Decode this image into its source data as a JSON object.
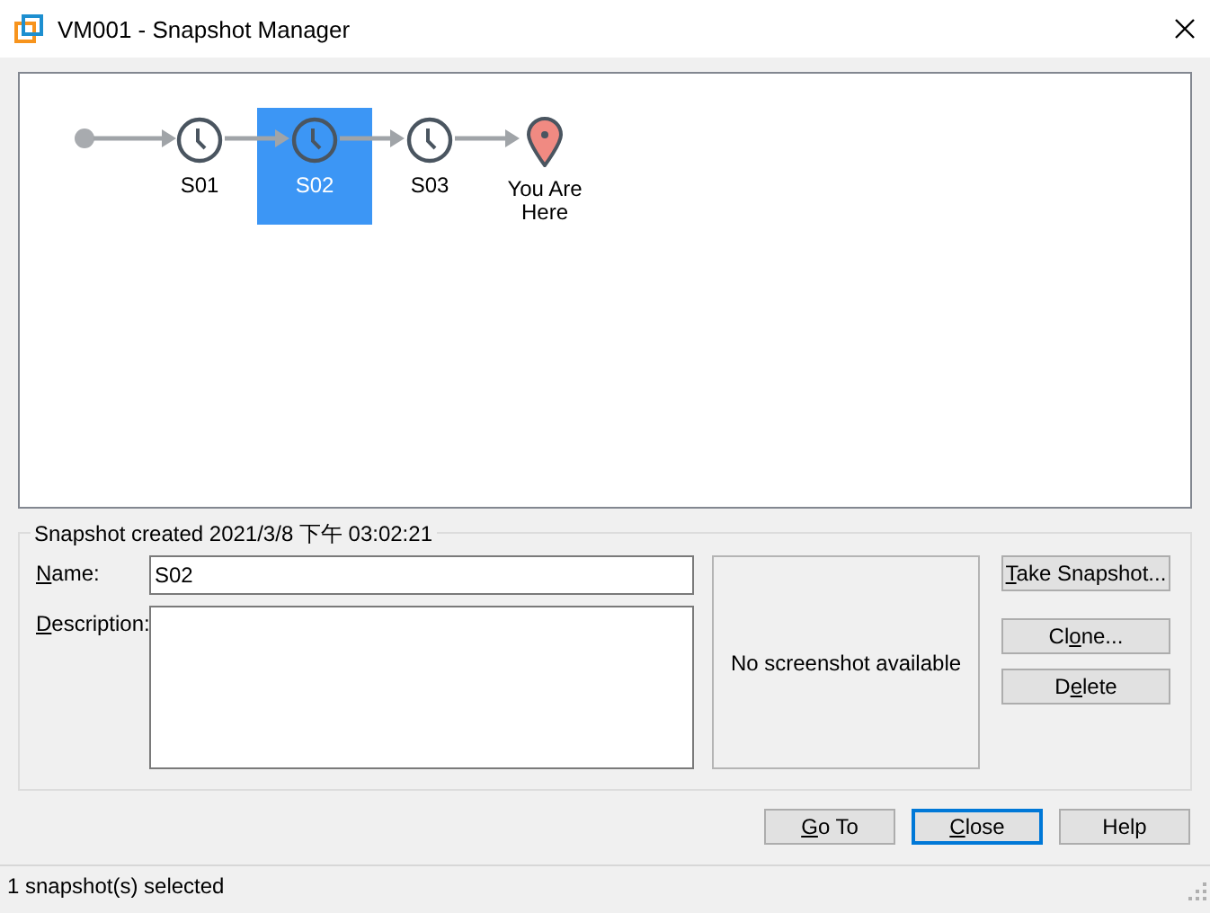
{
  "window": {
    "title": "VM001 - Snapshot Manager"
  },
  "snapshots": [
    {
      "kind": "snapshot",
      "label": "S01",
      "selected": false
    },
    {
      "kind": "snapshot",
      "label": "S02",
      "selected": true
    },
    {
      "kind": "snapshot",
      "label": "S03",
      "selected": false
    },
    {
      "kind": "current",
      "label": "You Are Here",
      "selected": false
    }
  ],
  "details": {
    "heading": "Snapshot created 2021/3/8 下午 03:02:21",
    "name_label": [
      {
        "text": "N",
        "underlined": true
      },
      {
        "text": "ame:",
        "underlined": false
      }
    ],
    "name_value": "S02",
    "description_label": [
      {
        "text": "D",
        "underlined": true
      },
      {
        "text": "escription:",
        "underlined": false
      }
    ],
    "preview_text": "No screenshot available"
  },
  "side_buttons": [
    {
      "label": [
        {
          "text": "T",
          "underlined": true
        },
        {
          "text": "ake Snapshot...",
          "underlined": false
        }
      ]
    },
    {
      "label": [
        {
          "text": "Cl",
          "underlined": false
        },
        {
          "text": "o",
          "underlined": true
        },
        {
          "text": "ne...",
          "underlined": false
        }
      ]
    },
    {
      "label": [
        {
          "text": "D",
          "underlined": false
        },
        {
          "text": "e",
          "underlined": true
        },
        {
          "text": "lete",
          "underlined": false
        }
      ]
    }
  ],
  "dialog_buttons": [
    {
      "label": [
        {
          "text": "G",
          "underlined": true
        },
        {
          "text": "o To",
          "underlined": false
        }
      ],
      "default": false
    },
    {
      "label": [
        {
          "text": "C",
          "underlined": true
        },
        {
          "text": "lose",
          "underlined": false
        }
      ],
      "default": true
    },
    {
      "label": [
        {
          "text": "Help",
          "underlined": false
        }
      ],
      "default": false
    }
  ],
  "status_bar": {
    "text": "1 snapshot(s) selected"
  }
}
